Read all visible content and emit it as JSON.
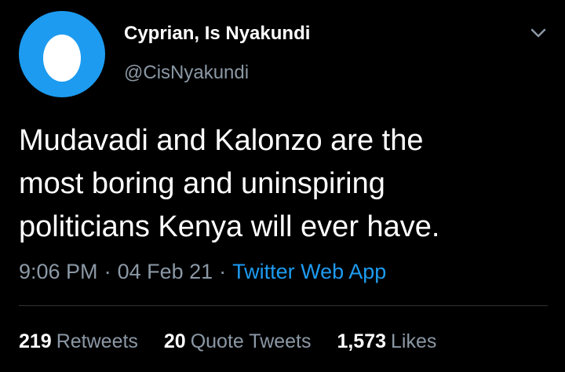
{
  "tweet": {
    "display_name": "Cyprian, Is Nyakundi",
    "handle": "@CisNyakundi",
    "text": "Mudavadi and Kalonzo are the\nmost boring and uninspiring\npoliticians Kenya will ever have.",
    "time": "9:06 PM",
    "separator": "·",
    "date": "04 Feb 21",
    "source": "Twitter Web App",
    "stats": [
      {
        "count": "219",
        "label": "Retweets"
      },
      {
        "count": "20",
        "label": "Quote Tweets"
      },
      {
        "count": "1,573",
        "label": "Likes"
      }
    ],
    "icons": {
      "avatar": "default-egg-avatar",
      "menu": "chevron-down-icon"
    },
    "colors": {
      "background": "#000000",
      "accent": "#1d9bf0",
      "secondary_text": "#8b98a5",
      "primary_text": "#ffffff"
    }
  }
}
